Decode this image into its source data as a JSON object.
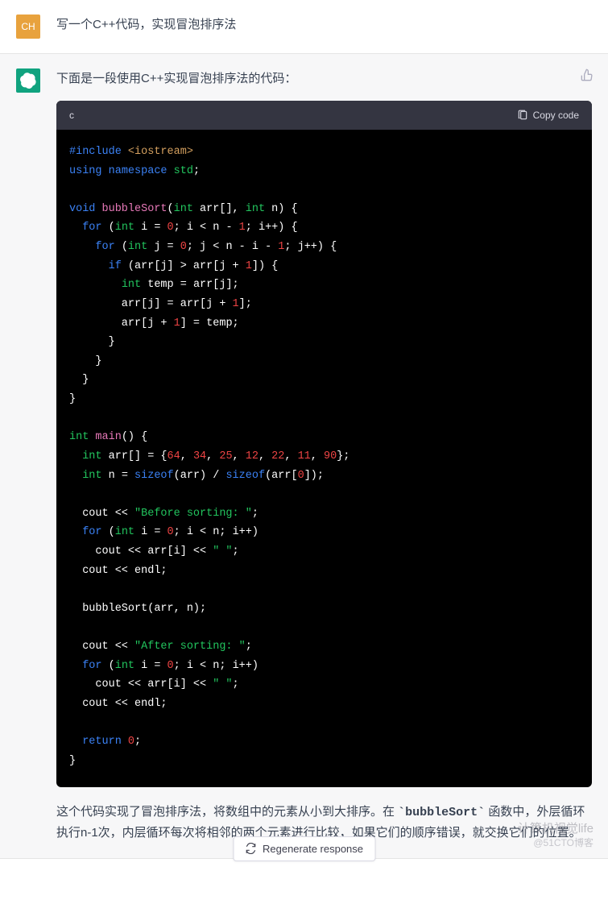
{
  "user": {
    "avatar_text": "CH",
    "prompt": "写一个C++代码，实现冒泡排序法"
  },
  "assistant": {
    "intro": "下面是一段使用C++实现冒泡排序法的代码：",
    "code_lang": "c",
    "copy_label": "Copy code",
    "explanation_pre": "这个代码实现了冒泡排序法，将数组中的元素从小到大排序。在 ",
    "explanation_code": "`bubbleSort`",
    "explanation_post": " 函数中，外层循环执行n-1次，内层循环每次将相邻的两个元素进行比较，如果它们的顺序错误，就交换它们的位置。"
  },
  "code": {
    "include": "#include",
    "iostream": " <iostream>",
    "using": "using",
    "namespace": " namespace",
    "std": " std",
    "void": "void",
    "bubbleSort": " bubbleSort",
    "int": "int",
    "arr_param": " arr[], ",
    "n_param": " n",
    "for": "for",
    "if": "if",
    "main": " main",
    "arr_decl": " arr[] = {",
    "vals": [
      "64",
      "34",
      "25",
      "12",
      "22",
      "11",
      "90"
    ],
    "sizeof": "sizeof",
    "before": "\"Before sorting: \"",
    "after": "\"After sorting: \"",
    "space": "\" \"",
    "return": "return",
    "zero": "0",
    "one": "1",
    "cout": "cout",
    "endl": "endl",
    "temp": "temp"
  },
  "regen_label": "Regenerate response",
  "watermark": {
    "line1": "计算机视觉life",
    "line2": "@51CTO博客"
  }
}
